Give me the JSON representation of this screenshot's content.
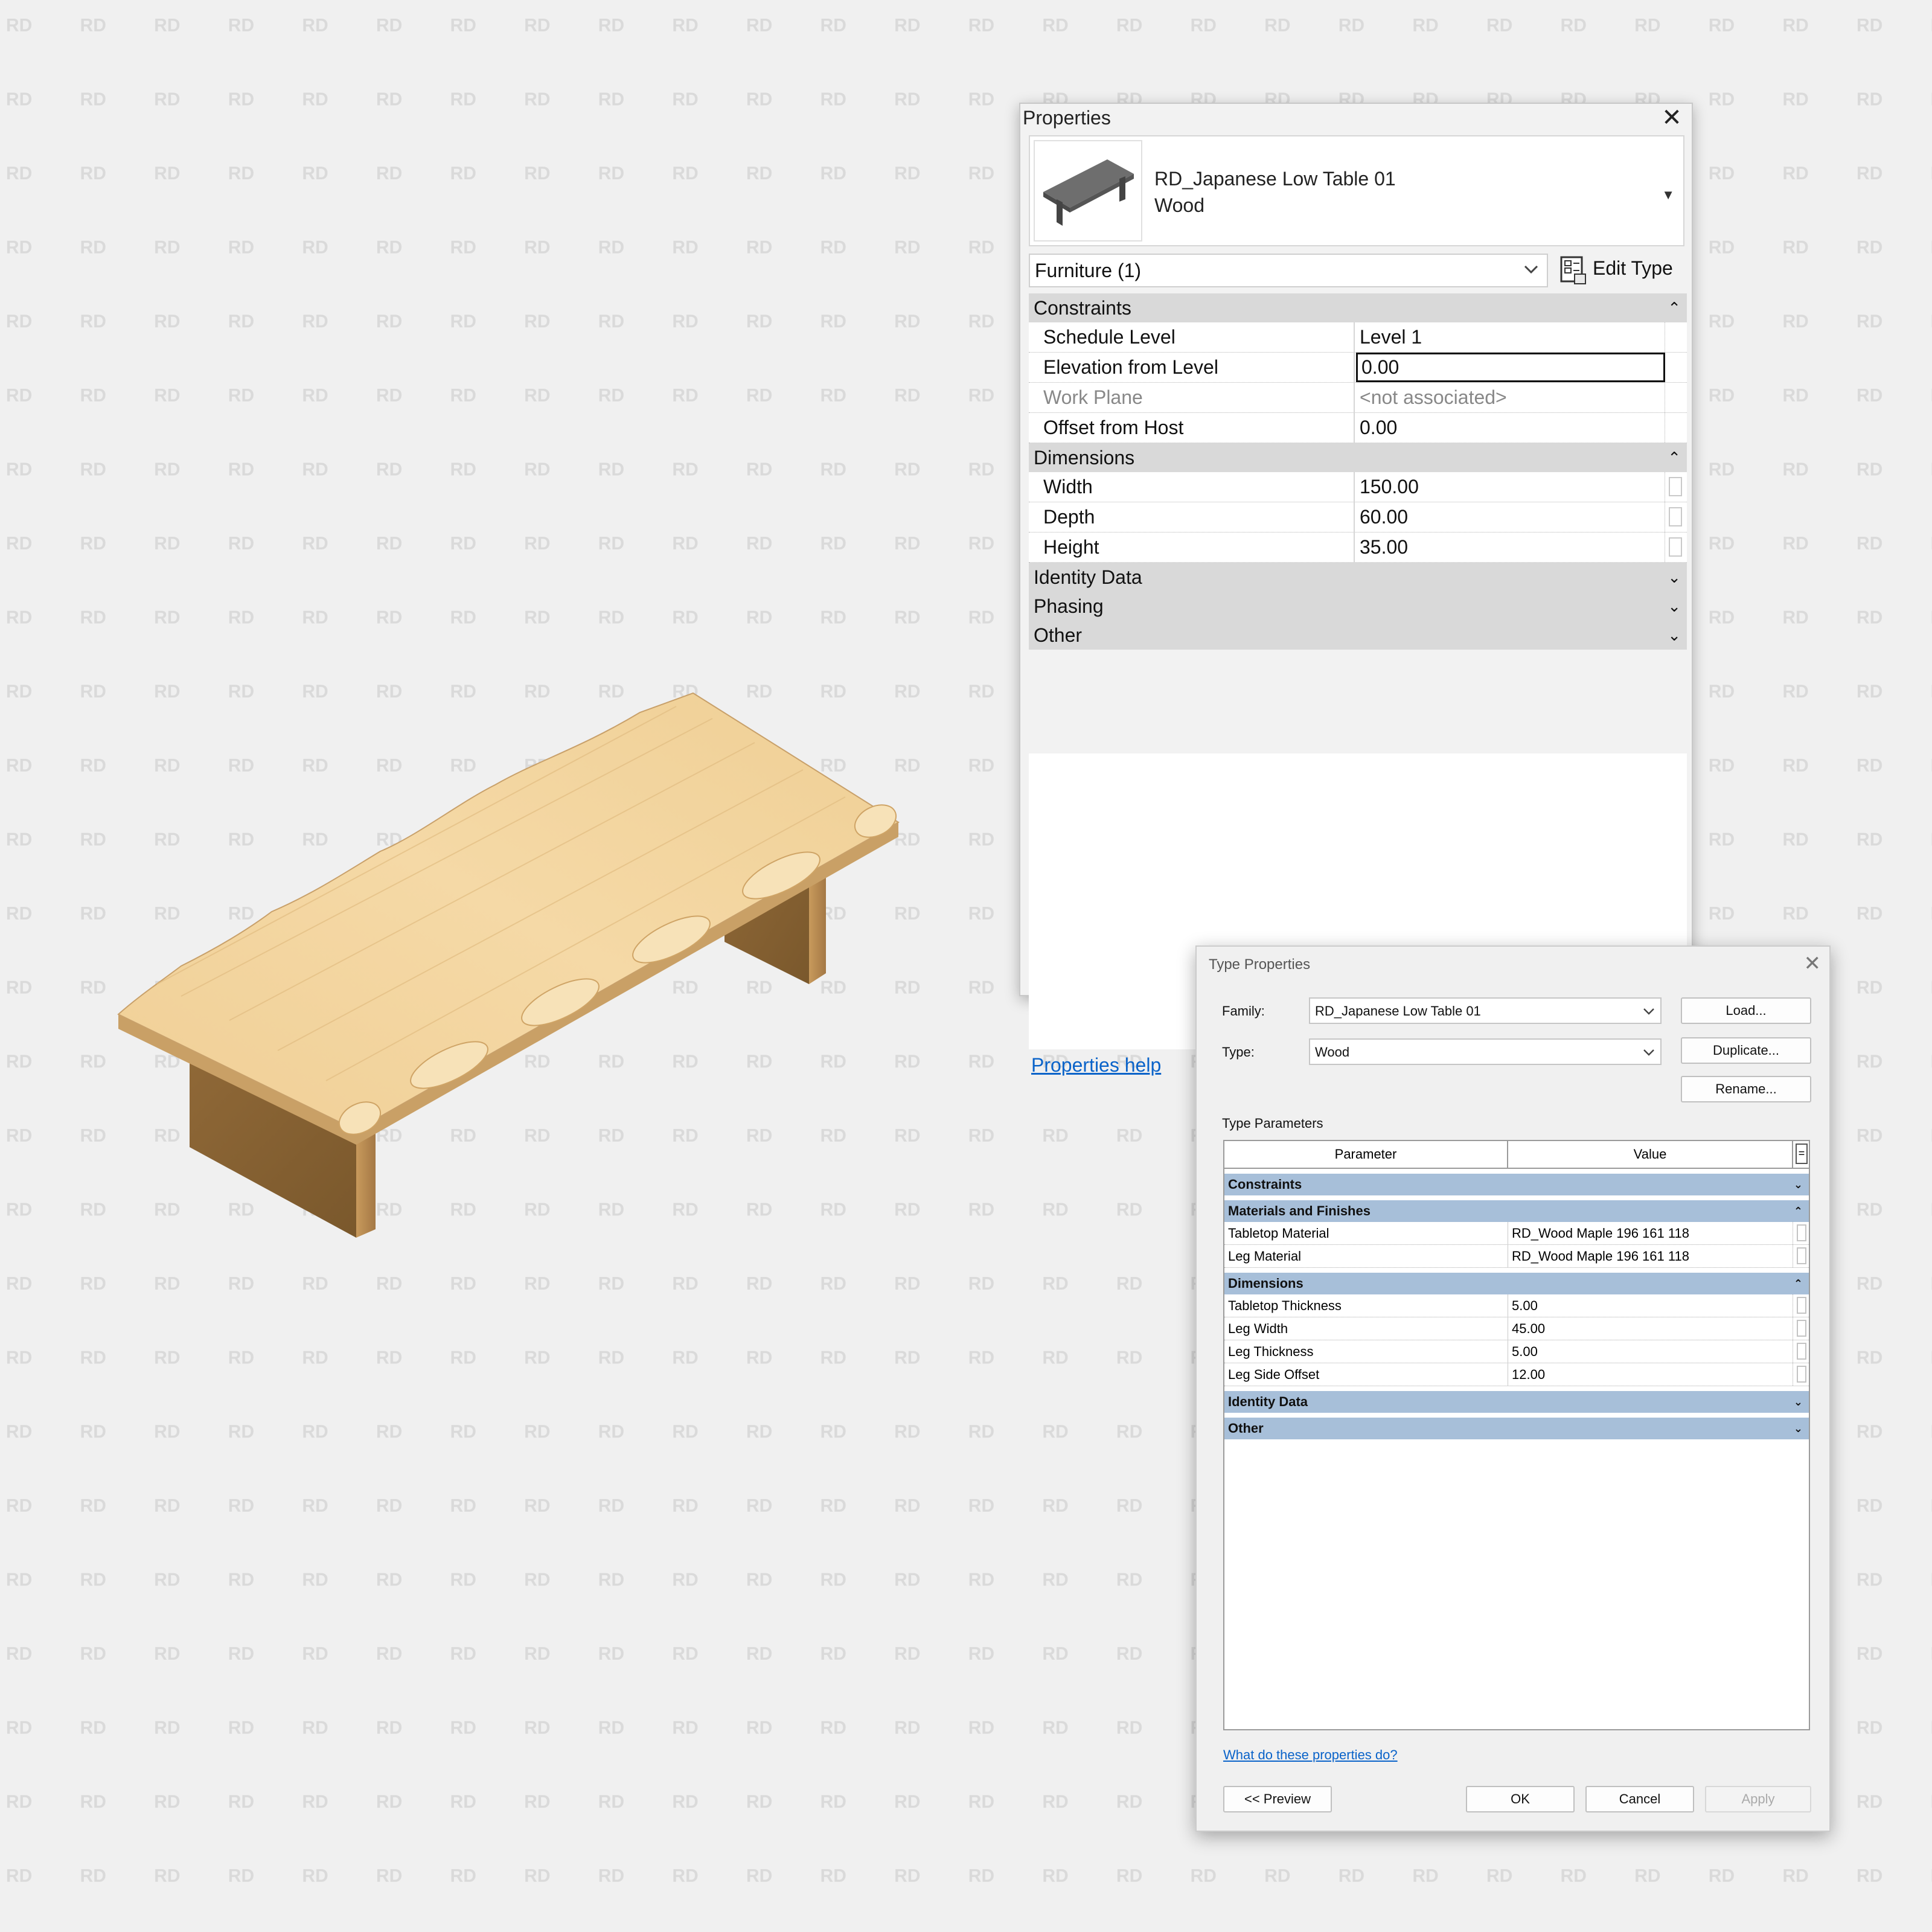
{
  "colors": {
    "background": "#f0f0f0",
    "watermark": "#d8d8d8",
    "group_header": "#d9d9d9",
    "type_group_header": "#a7bfd9",
    "link": "#0a63c9",
    "wood_top": "#efcf95",
    "wood_side": "#a07640"
  },
  "watermark_text": "RD",
  "properties": {
    "title": "Properties",
    "close_icon": "close-icon",
    "family_name": "RD_Japanese Low Table 01",
    "type_name": "Wood",
    "instance_filter": "Furniture (1)",
    "edit_type_label": "Edit Type",
    "groups": [
      {
        "name": "Constraints",
        "expanded": true,
        "rows": [
          {
            "label": "Schedule Level",
            "value": "Level 1"
          },
          {
            "label": "Elevation from Level",
            "value": "0.00"
          },
          {
            "label": "Work Plane",
            "value": "<not associated>"
          },
          {
            "label": "Offset from Host",
            "value": "0.00"
          }
        ]
      },
      {
        "name": "Dimensions",
        "expanded": true,
        "rows": [
          {
            "label": "Width",
            "value": "150.00"
          },
          {
            "label": "Depth",
            "value": "60.00"
          },
          {
            "label": "Height",
            "value": "35.00"
          }
        ]
      },
      {
        "name": "Identity Data",
        "expanded": false
      },
      {
        "name": "Phasing",
        "expanded": false
      },
      {
        "name": "Other",
        "expanded": false
      }
    ],
    "help_link": "Properties help"
  },
  "type_properties": {
    "title": "Type Properties",
    "family_label": "Family:",
    "family_value": "RD_Japanese Low Table 01",
    "type_label": "Type:",
    "type_value": "Wood",
    "load_label": "Load...",
    "duplicate_label": "Duplicate...",
    "rename_label": "Rename...",
    "section_label": "Type Parameters",
    "col_parameter": "Parameter",
    "col_value": "Value",
    "col_toggle": "=",
    "groups": [
      {
        "name": "Constraints",
        "expanded": false
      },
      {
        "name": "Materials and Finishes",
        "expanded": true,
        "rows": [
          {
            "param": "Tabletop Material",
            "value": "RD_Wood Maple 196 161 118"
          },
          {
            "param": "Leg Material",
            "value": "RD_Wood Maple 196 161 118"
          }
        ]
      },
      {
        "name": "Dimensions",
        "expanded": true,
        "rows": [
          {
            "param": "Tabletop Thickness",
            "value": "5.00"
          },
          {
            "param": "Leg Width",
            "value": "45.00"
          },
          {
            "param": "Leg Thickness",
            "value": "5.00"
          },
          {
            "param": "Leg Side Offset",
            "value": "12.00"
          }
        ]
      },
      {
        "name": "Identity Data",
        "expanded": false
      },
      {
        "name": "Other",
        "expanded": false
      }
    ],
    "help_link": "What do these properties do?",
    "preview_label": "<< Preview",
    "ok_label": "OK",
    "cancel_label": "Cancel",
    "apply_label": "Apply"
  },
  "icons": {
    "close": "close-icon",
    "collapse": "double-chevron-up-icon",
    "expand": "double-chevron-down-icon",
    "dropdown": "chevron-down-icon",
    "edit_type": "edit-type-icon",
    "assoc": "associate-parameter-icon"
  }
}
